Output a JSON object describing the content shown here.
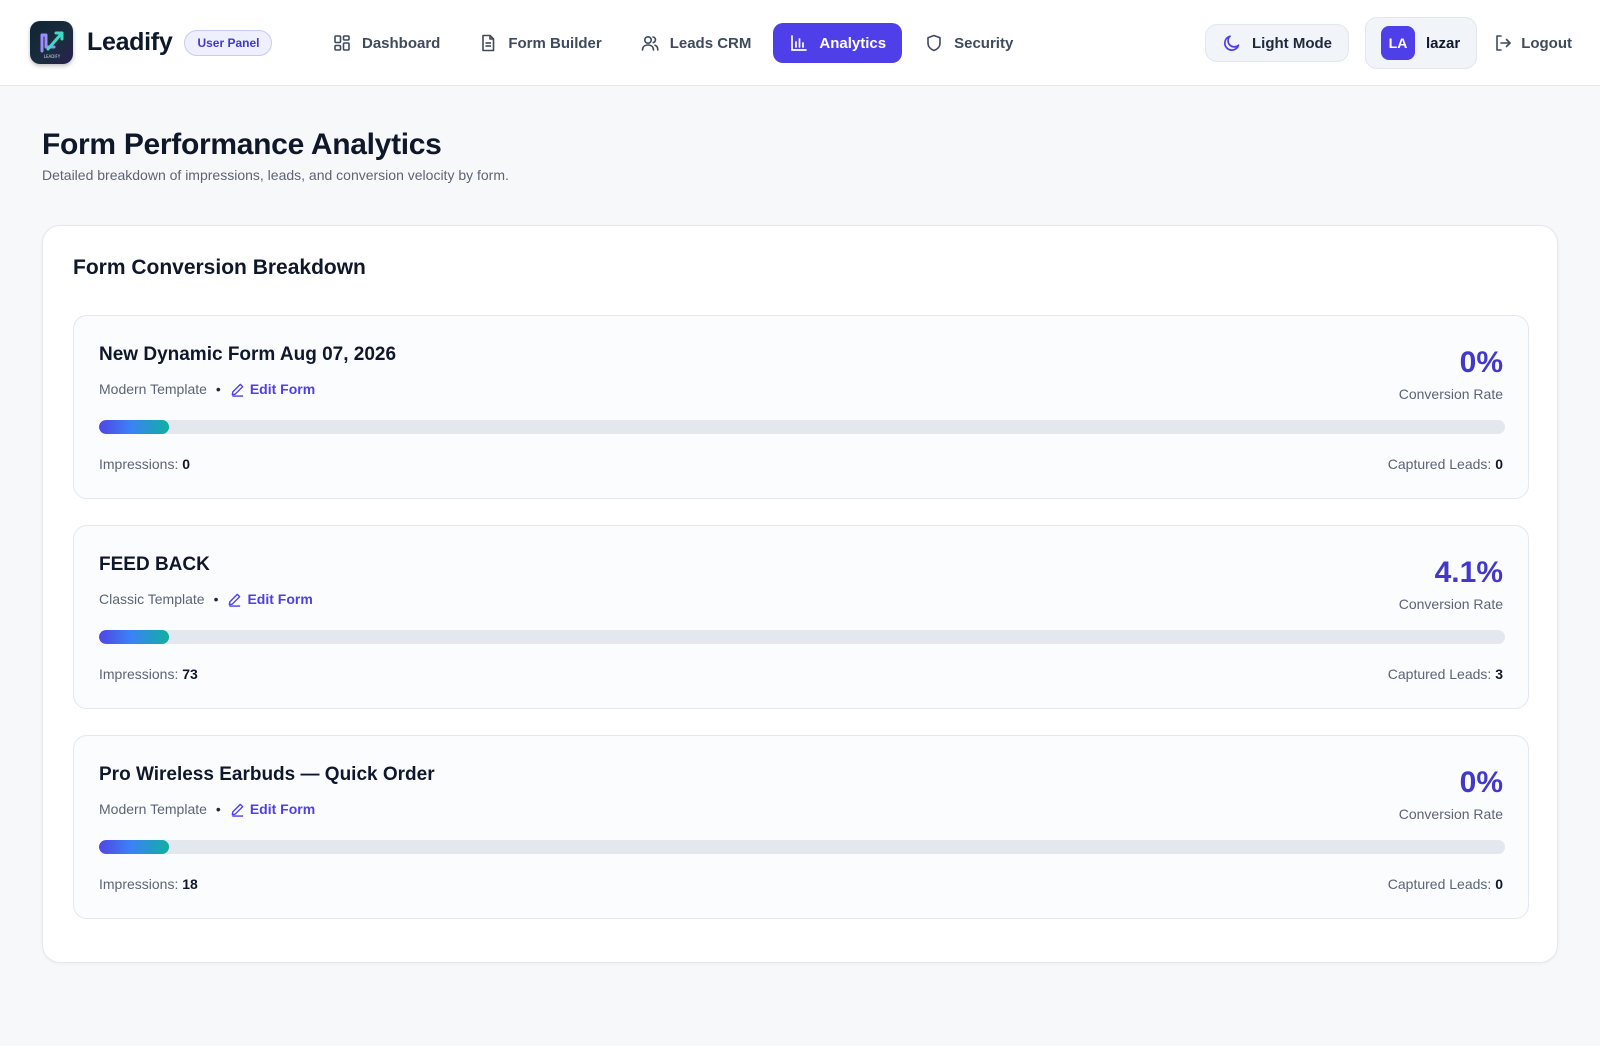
{
  "brand": {
    "name": "Leadify",
    "badge": "User Panel",
    "logo_text": "LEADIFY"
  },
  "nav": {
    "items": [
      {
        "label": "Dashboard",
        "icon": "grid-icon",
        "active": false
      },
      {
        "label": "Form Builder",
        "icon": "document-icon",
        "active": false
      },
      {
        "label": "Leads CRM",
        "icon": "users-icon",
        "active": false
      },
      {
        "label": "Analytics",
        "icon": "bar-chart-icon",
        "active": true
      },
      {
        "label": "Security",
        "icon": "shield-icon",
        "active": false
      }
    ]
  },
  "toolbar": {
    "mode_label": "Light Mode",
    "user_initials": "LA",
    "username": "lazar",
    "logout_label": "Logout"
  },
  "header": {
    "title": "Form Performance Analytics",
    "subtitle": "Detailed breakdown of impressions, leads, and conversion velocity by form."
  },
  "section": {
    "title": "Form Conversion Breakdown"
  },
  "labels": {
    "conversion_rate": "Conversion Rate",
    "impressions": "Impressions:",
    "captured_leads": "Captured Leads:",
    "edit_form": "Edit Form",
    "separator": "•"
  },
  "forms": [
    {
      "name": "New Dynamic Form Aug 07, 2026",
      "template": "Modern Template",
      "rate": "0%",
      "impressions": "0",
      "leads": "0",
      "bar_fill_percent": 5
    },
    {
      "name": "FEED BACK",
      "template": "Classic Template",
      "rate": "4.1%",
      "impressions": "73",
      "leads": "3",
      "bar_fill_percent": 5
    },
    {
      "name": "Pro Wireless Earbuds — Quick Order",
      "template": "Modern Template",
      "rate": "0%",
      "impressions": "18",
      "leads": "0",
      "bar_fill_percent": 5
    }
  ],
  "colors": {
    "accent": "#4f3fe8",
    "rate": "#4338ca",
    "teal": "#10b0a0"
  }
}
